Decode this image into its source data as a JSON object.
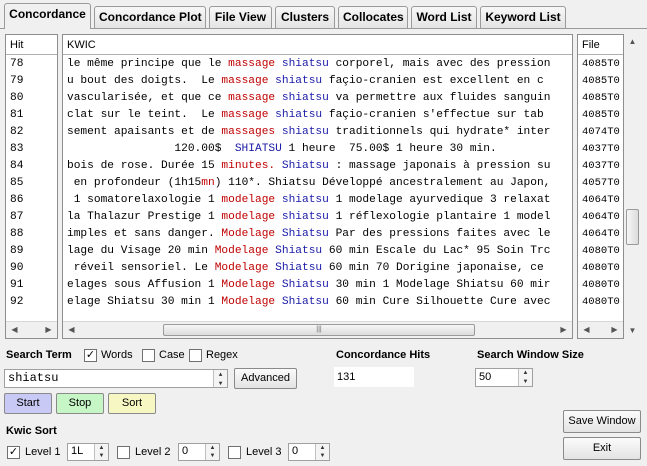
{
  "tabs": [
    "Concordance",
    "Concordance Plot",
    "File View",
    "Clusters",
    "Collocates",
    "Word List",
    "Keyword List"
  ],
  "columns": {
    "hit": "Hit",
    "kwic": "KWIC",
    "file": "File"
  },
  "rows": [
    {
      "hit": "78",
      "pre": "le même principe que le ",
      "kw1": "massage",
      "kw2": "shiatsu",
      "post": " corporel, mais avec des pression",
      "file": "4085T0"
    },
    {
      "hit": "79",
      "pre": "u bout des doigts.  Le ",
      "kw1": "massage",
      "kw2": "shiatsu",
      "post": " façio-cranien est excellent en c",
      "file": "4085T0"
    },
    {
      "hit": "80",
      "pre": "vascularisée, et que ce ",
      "kw1": "massage",
      "kw2": "shiatsu",
      "post": " va permettre aux fluides sanguin",
      "file": "4085T0"
    },
    {
      "hit": "81",
      "pre": "clat sur le teint.  Le ",
      "kw1": "massage",
      "kw2": "shiatsu",
      "post": " façio-cranien s'effectue sur tab",
      "file": "4085T0"
    },
    {
      "hit": "82",
      "pre": "sement apaisants et de ",
      "kw1": "massages",
      "kw2": "shiatsu",
      "post": " traditionnels qui hydrate* inter",
      "file": "4074T0"
    },
    {
      "hit": "83",
      "pre": "                120.00$  ",
      "kw1": "",
      "kw2": "SHIATSU",
      "post": " 1 heure  75.00$ 1 heure 30 min.",
      "file": "4037T0"
    },
    {
      "hit": "84",
      "pre": "bois de rose. Durée 15 ",
      "kw1": "minutes.",
      "kw2": "Shiatsu",
      "post": " : massage japonais à pression su",
      "file": "4037T0"
    },
    {
      "hit": "85",
      "pre": " en profondeur (1h15",
      "kw1": "mn",
      "kw2": "",
      "post": ") 110*. Shiatsu Développé ancestralement au Japon,",
      "file": "4057T0"
    },
    {
      "hit": "86",
      "pre": " 1 somatorelaxologie 1 ",
      "kw1": "modelage",
      "kw2": "shiatsu",
      "post": " 1 modelage ayurvedique 3 relaxat",
      "file": "4064T0"
    },
    {
      "hit": "87",
      "pre": "la Thalazur Prestige 1 ",
      "kw1": "modelage",
      "kw2": "shiatsu",
      "post": " 1 réflexologie plantaire 1 model",
      "file": "4064T0"
    },
    {
      "hit": "88",
      "pre": "imples et sans danger. ",
      "kw1": "Modelage",
      "kw2": "Shiatsu",
      "post": " Par des pressions faites avec le",
      "file": "4064T0"
    },
    {
      "hit": "89",
      "pre": "lage du Visage 20 min ",
      "kw1": "Modelage",
      "kw2": "Shiatsu",
      "post": " 60 min Escale du Lac* 95 Soin Trc",
      "file": "4080T0"
    },
    {
      "hit": "90",
      "pre": " réveil sensoriel. Le ",
      "kw1": "Modelage",
      "kw2": "Shiatsu",
      "post": " 60 min 70 Dorigine japonaise, ce",
      "file": "4080T0"
    },
    {
      "hit": "91",
      "pre": "elages sous Affusion 1 ",
      "kw1": "Modelage",
      "kw2": "Shiatsu",
      "post": " 30 min 1 Modelage Shiatsu 60 mir",
      "file": "4080T0"
    },
    {
      "hit": "92",
      "pre": "elage Shiatsu 30 min 1 ",
      "kw1": "Modelage",
      "kw2": "Shiatsu",
      "post": " 60 min Cure Silhouette Cure avec",
      "file": "4080T0"
    }
  ],
  "search": {
    "term_label": "Search Term",
    "words_label": "Words",
    "case_label": "Case",
    "regex_label": "Regex",
    "value": "shiatsu",
    "advanced_label": "Advanced"
  },
  "hits": {
    "label": "Concordance Hits",
    "value": "131"
  },
  "window": {
    "label": "Search Window Size",
    "value": "50"
  },
  "buttons": {
    "start": "Start",
    "stop": "Stop",
    "sort": "Sort",
    "save_window": "Save Window",
    "exit": "Exit"
  },
  "kwic_sort": {
    "label": "Kwic Sort",
    "level1_label": "Level 1",
    "level1_value": "1L",
    "level2_label": "Level 2",
    "level2_value": "0",
    "level3_label": "Level 3",
    "level3_value": "0"
  },
  "colors": {
    "keyword_red": "#c00000",
    "keyword_blue": "#1a1aa8",
    "start_btn": "#c9c9f5",
    "stop_btn": "#c6f5c6",
    "sort_btn": "#f7f7c4"
  }
}
